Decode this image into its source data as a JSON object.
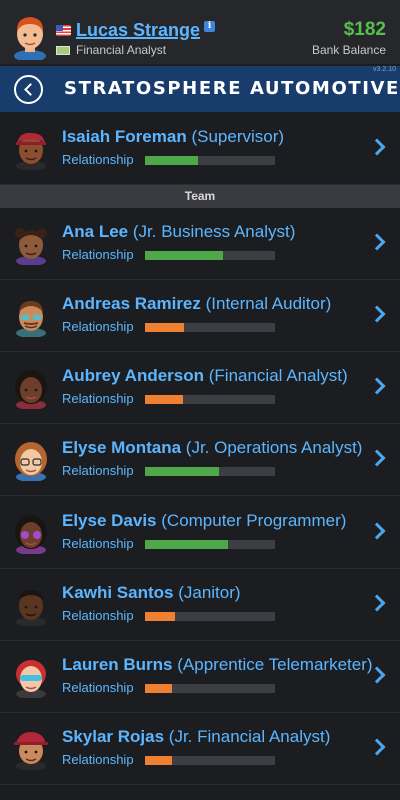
{
  "player": {
    "name": "Lucas Strange",
    "job": "Financial Analyst",
    "money": "$182",
    "bank_label": "Bank Balance",
    "info_glyph": "i",
    "version": "v3.2.10"
  },
  "header": {
    "company": "STRATOSPHERE AUTOMOTIVE"
  },
  "relationship_label": "Relationship",
  "section_team": "Team",
  "colors": {
    "good": "#4ea84a",
    "low": "#ef7f31",
    "accent": "#5cb6ff",
    "header": "#183d6c"
  },
  "supervisor": {
    "name": "Isaiah Foreman",
    "role": "(Supervisor)",
    "relationship": 0.41,
    "level": "good"
  },
  "team": [
    {
      "name": "Ana Lee",
      "role": "(Jr. Business Analyst)",
      "relationship": 0.6,
      "level": "good"
    },
    {
      "name": "Andreas Ramirez",
      "role": "(Internal Auditor)",
      "relationship": 0.3,
      "level": "low"
    },
    {
      "name": "Aubrey Anderson",
      "role": "(Financial Analyst)",
      "relationship": 0.29,
      "level": "low"
    },
    {
      "name": "Elyse Montana",
      "role": "(Jr. Operations Analyst)",
      "relationship": 0.57,
      "level": "good"
    },
    {
      "name": "Elyse Davis",
      "role": "(Computer Programmer)",
      "relationship": 0.64,
      "level": "good"
    },
    {
      "name": "Kawhi Santos",
      "role": "(Janitor)",
      "relationship": 0.23,
      "level": "low"
    },
    {
      "name": "Lauren Burns",
      "role": "(Apprentice Telemarketer)",
      "relationship": 0.21,
      "level": "low"
    },
    {
      "name": "Skylar Rojas",
      "role": "(Jr. Financial Analyst)",
      "relationship": 0.21,
      "level": "low"
    }
  ]
}
